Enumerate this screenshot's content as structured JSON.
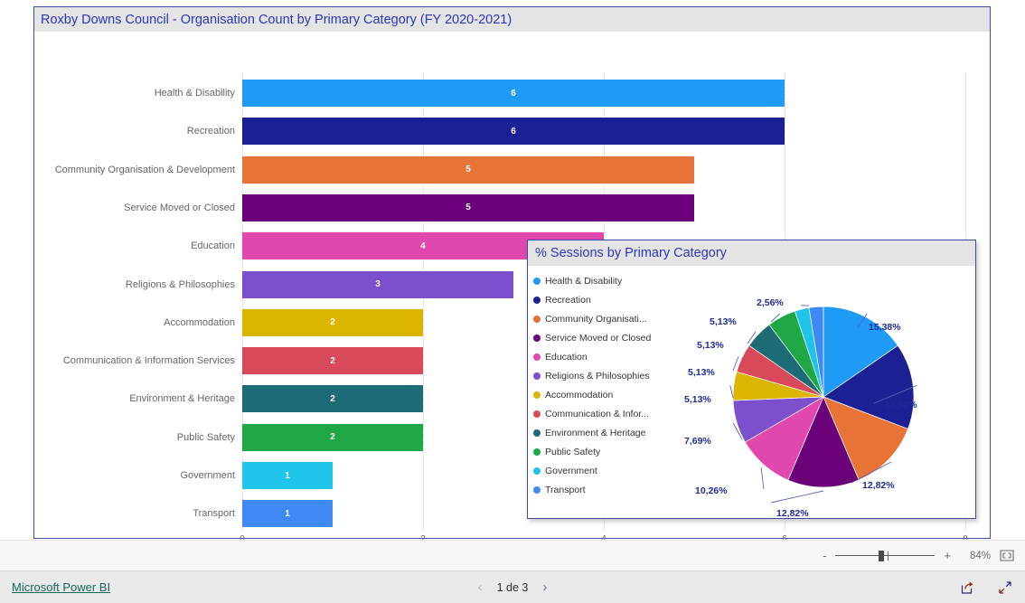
{
  "bar_visual": {
    "title": "Roxby Downs Council - Organisation Count by Primary Category (FY 2020-2021)"
  },
  "pie_visual": {
    "title": "% Sessions by Primary Category"
  },
  "zoom_bar": {
    "minus_label": "-",
    "plus_label": "+",
    "zoom_level": "84%"
  },
  "footer": {
    "brand": "Microsoft Power BI",
    "prev_arrow": "‹",
    "next_arrow": "›",
    "page_indicator": "1 de 3"
  },
  "chart_data": [
    {
      "type": "bar",
      "orientation": "horizontal",
      "title": "Roxby Downs Council - Organisation Count by Primary Category (FY 2020-2021)",
      "xlabel": "",
      "ylabel": "",
      "xlim": [
        0,
        8
      ],
      "xticks": [
        "0",
        "2",
        "4",
        "6",
        "8"
      ],
      "grid": true,
      "categories": [
        "Health & Disability",
        "Recreation",
        "Community Organisation & Development",
        "Service Moved or Closed",
        "Education",
        "Religions & Philosophies",
        "Accommodation",
        "Communication & Information Services",
        "Environment & Heritage",
        "Public Safety",
        "Government",
        "Transport"
      ],
      "values": [
        6,
        6,
        5,
        5,
        4,
        3,
        2,
        2,
        2,
        2,
        1,
        1
      ],
      "colors": [
        "#1f9bf5",
        "#1b2195",
        "#e87337",
        "#6b0279",
        "#e048ad",
        "#7c50cc",
        "#dcb500",
        "#d8495a",
        "#1c6b75",
        "#1ea744",
        "#1ec4ea",
        "#4088f4"
      ]
    },
    {
      "type": "pie",
      "title": "% Sessions by Primary Category",
      "legend_position": "left",
      "labels": [
        "Health & Disability",
        "Recreation",
        "Community Organisati...",
        "Service Moved or Closed",
        "Education",
        "Religions & Philosophies",
        "Accommodation",
        "Communication & Infor...",
        "Environment & Heritage",
        "Public Safety",
        "Government",
        "Transport"
      ],
      "values": [
        15.38,
        15.38,
        12.82,
        12.82,
        10.26,
        7.69,
        5.13,
        5.13,
        5.13,
        5.13,
        2.56,
        2.56
      ],
      "value_labels": [
        "15,38%",
        "15,38%",
        "12,82%",
        "12,82%",
        "10,26%",
        "7,69%",
        "5,13%",
        "5,13%",
        "5,13%",
        "5,13%",
        "2,56%",
        ""
      ],
      "colors": [
        "#1f9bf5",
        "#1b2195",
        "#e87337",
        "#6b0279",
        "#e048ad",
        "#7c50cc",
        "#dcb500",
        "#d8495a",
        "#1c6b75",
        "#1ea744",
        "#1ec4ea",
        "#4088f4"
      ]
    }
  ]
}
